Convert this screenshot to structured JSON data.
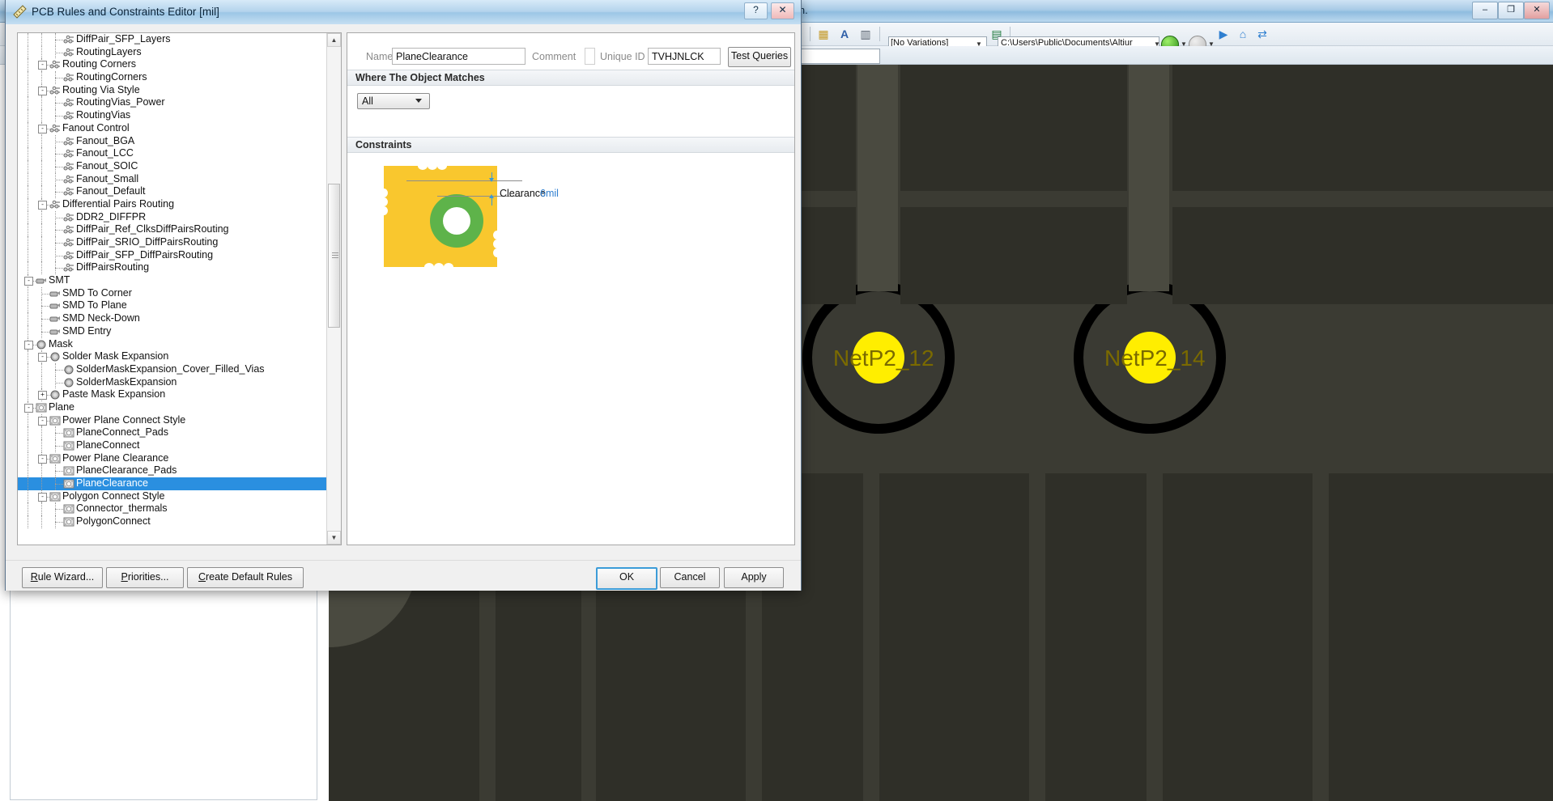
{
  "app": {
    "title_fragment": "in.",
    "window_buttons": {
      "minimize": "–",
      "maximize": "❐",
      "close": "✕"
    },
    "toolbar": {
      "variations_value": "[No Variations]",
      "path_value": "C:\\Users\\Public\\Documents\\Altiur",
      "icons": [
        "grid-icon",
        "text-icon",
        "component-icon",
        "excel-icon",
        "back-icon",
        "forward-icon",
        "panel-icon",
        "home-icon",
        "refresh-icon"
      ]
    }
  },
  "pcb": {
    "net_labels": [
      "NetP2_12",
      "NetP2_14"
    ],
    "colors": {
      "background": "#3b3b33",
      "copper": "#4a4a40",
      "pad_hole": "#ffee00",
      "pad_ring": "#000000"
    }
  },
  "dialog": {
    "title": "PCB Rules and Constraints Editor [mil]",
    "icon": "ruler-icon",
    "help_button": "?",
    "close_button": "✕",
    "tree": {
      "scroll_up": "▲",
      "scroll_down": "▼",
      "items": [
        {
          "label": "DiffPair_SFP_Layers",
          "depth": 3,
          "icon": "routing-icon",
          "expander": null,
          "selected": false
        },
        {
          "label": "RoutingLayers",
          "depth": 3,
          "icon": "routing-icon",
          "expander": null,
          "selected": false
        },
        {
          "label": "Routing Corners",
          "depth": 2,
          "icon": "routing-icon",
          "expander": "-",
          "selected": false
        },
        {
          "label": "RoutingCorners",
          "depth": 3,
          "icon": "routing-icon",
          "expander": null,
          "selected": false
        },
        {
          "label": "Routing Via Style",
          "depth": 2,
          "icon": "routing-icon",
          "expander": "-",
          "selected": false
        },
        {
          "label": "RoutingVias_Power",
          "depth": 3,
          "icon": "routing-icon",
          "expander": null,
          "selected": false
        },
        {
          "label": "RoutingVias",
          "depth": 3,
          "icon": "routing-icon",
          "expander": null,
          "selected": false
        },
        {
          "label": "Fanout Control",
          "depth": 2,
          "icon": "routing-icon",
          "expander": "-",
          "selected": false
        },
        {
          "label": "Fanout_BGA",
          "depth": 3,
          "icon": "routing-icon",
          "expander": null,
          "selected": false
        },
        {
          "label": "Fanout_LCC",
          "depth": 3,
          "icon": "routing-icon",
          "expander": null,
          "selected": false
        },
        {
          "label": "Fanout_SOIC",
          "depth": 3,
          "icon": "routing-icon",
          "expander": null,
          "selected": false
        },
        {
          "label": "Fanout_Small",
          "depth": 3,
          "icon": "routing-icon",
          "expander": null,
          "selected": false
        },
        {
          "label": "Fanout_Default",
          "depth": 3,
          "icon": "routing-icon",
          "expander": null,
          "selected": false
        },
        {
          "label": "Differential Pairs Routing",
          "depth": 2,
          "icon": "routing-icon",
          "expander": "-",
          "selected": false
        },
        {
          "label": "DDR2_DIFFPR",
          "depth": 3,
          "icon": "routing-icon",
          "expander": null,
          "selected": false
        },
        {
          "label": "DiffPair_Ref_ClksDiffPairsRouting",
          "depth": 3,
          "icon": "routing-icon",
          "expander": null,
          "selected": false
        },
        {
          "label": "DiffPair_SRIO_DiffPairsRouting",
          "depth": 3,
          "icon": "routing-icon",
          "expander": null,
          "selected": false
        },
        {
          "label": "DiffPair_SFP_DiffPairsRouting",
          "depth": 3,
          "icon": "routing-icon",
          "expander": null,
          "selected": false
        },
        {
          "label": "DiffPairsRouting",
          "depth": 3,
          "icon": "routing-icon",
          "expander": null,
          "selected": false
        },
        {
          "label": "SMT",
          "depth": 1,
          "icon": "smt-icon",
          "expander": "-",
          "selected": false
        },
        {
          "label": "SMD To Corner",
          "depth": 2,
          "icon": "smt-icon",
          "expander": null,
          "selected": false
        },
        {
          "label": "SMD To Plane",
          "depth": 2,
          "icon": "smt-icon",
          "expander": null,
          "selected": false
        },
        {
          "label": "SMD Neck-Down",
          "depth": 2,
          "icon": "smt-icon",
          "expander": null,
          "selected": false
        },
        {
          "label": "SMD Entry",
          "depth": 2,
          "icon": "smt-icon",
          "expander": null,
          "selected": false
        },
        {
          "label": "Mask",
          "depth": 1,
          "icon": "mask-icon",
          "expander": "-",
          "selected": false
        },
        {
          "label": "Solder Mask Expansion",
          "depth": 2,
          "icon": "mask-icon",
          "expander": "-",
          "selected": false
        },
        {
          "label": "SolderMaskExpansion_Cover_Filled_Vias",
          "depth": 3,
          "icon": "mask-icon",
          "expander": null,
          "selected": false
        },
        {
          "label": "SolderMaskExpansion",
          "depth": 3,
          "icon": "mask-icon",
          "expander": null,
          "selected": false
        },
        {
          "label": "Paste Mask Expansion",
          "depth": 2,
          "icon": "mask-icon",
          "expander": "+",
          "selected": false
        },
        {
          "label": "Plane",
          "depth": 1,
          "icon": "plane-icon",
          "expander": "-",
          "selected": false
        },
        {
          "label": "Power Plane Connect Style",
          "depth": 2,
          "icon": "plane-icon",
          "expander": "-",
          "selected": false
        },
        {
          "label": "PlaneConnect_Pads",
          "depth": 3,
          "icon": "plane-icon",
          "expander": null,
          "selected": false
        },
        {
          "label": "PlaneConnect",
          "depth": 3,
          "icon": "plane-icon",
          "expander": null,
          "selected": false
        },
        {
          "label": "Power Plane Clearance",
          "depth": 2,
          "icon": "plane-icon",
          "expander": "-",
          "selected": false
        },
        {
          "label": "PlaneClearance_Pads",
          "depth": 3,
          "icon": "plane-icon",
          "expander": null,
          "selected": false
        },
        {
          "label": "PlaneClearance",
          "depth": 3,
          "icon": "plane-icon",
          "expander": null,
          "selected": true
        },
        {
          "label": "Polygon Connect Style",
          "depth": 2,
          "icon": "plane-icon",
          "expander": "-",
          "selected": false
        },
        {
          "label": "Connector_thermals",
          "depth": 3,
          "icon": "plane-icon",
          "expander": null,
          "selected": false
        },
        {
          "label": "PolygonConnect",
          "depth": 3,
          "icon": "plane-icon",
          "expander": null,
          "selected": false
        }
      ]
    },
    "detail": {
      "name_label": "Name",
      "name_value": "PlaneClearance",
      "comment_label": "Comment",
      "comment_value": "",
      "unique_id_label": "Unique ID",
      "unique_id_value": "TVHJNLCK",
      "test_queries_button": "Test Queries",
      "where_header": "Where The Object Matches",
      "scope_value": "All",
      "constraints_header": "Constraints",
      "clearance_label": "Clearance",
      "clearance_value": "6mil"
    },
    "footer": {
      "rule_wizard": "Rule Wizard...",
      "priorities": "Priorities...",
      "create_default_rules": "Create Default Rules",
      "ok": "OK",
      "cancel": "Cancel",
      "apply": "Apply"
    }
  }
}
